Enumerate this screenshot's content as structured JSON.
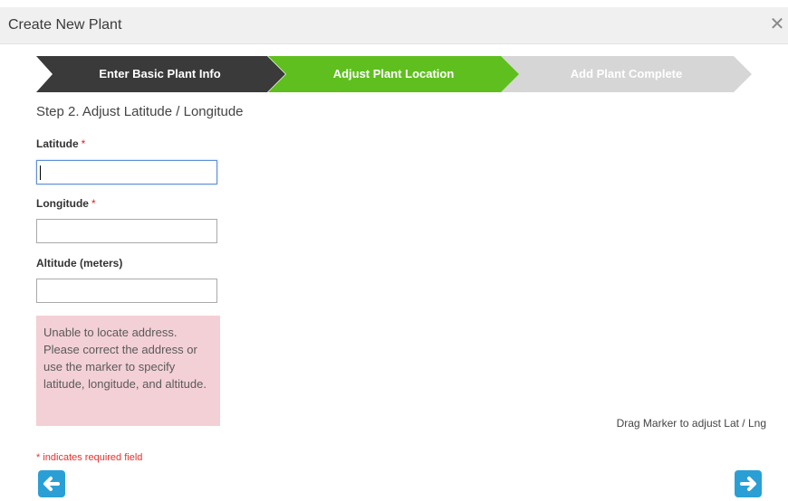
{
  "dialog": {
    "title": "Create New Plant",
    "close_symbol": "✕"
  },
  "wizard": {
    "steps": [
      {
        "label": "Enter Basic Plant Info",
        "state": "done",
        "color": "#3a3a3a"
      },
      {
        "label": "Adjust Plant Location",
        "state": "active",
        "color": "#5fbf1e"
      },
      {
        "label": "Add Plant Complete",
        "state": "pending",
        "color": "#d6d6d6"
      }
    ]
  },
  "form": {
    "heading": "Step 2. Adjust Latitude / Longitude",
    "required_mark": "*",
    "latitude": {
      "label": "Latitude",
      "value": ""
    },
    "longitude": {
      "label": "Longitude",
      "value": ""
    },
    "altitude": {
      "label": "Altitude (meters)",
      "value": ""
    },
    "error_message": "Unable to locate address. Please correct the address or use the marker to specify latitude, longitude, and altitude.",
    "required_note": "* indicates required field"
  },
  "map": {
    "hint": "Drag Marker to adjust Lat / Lng"
  },
  "navigation": {
    "back_icon": "arrow-left-icon",
    "next_icon": "arrow-right-icon",
    "button_color": "#2a9fd6"
  }
}
